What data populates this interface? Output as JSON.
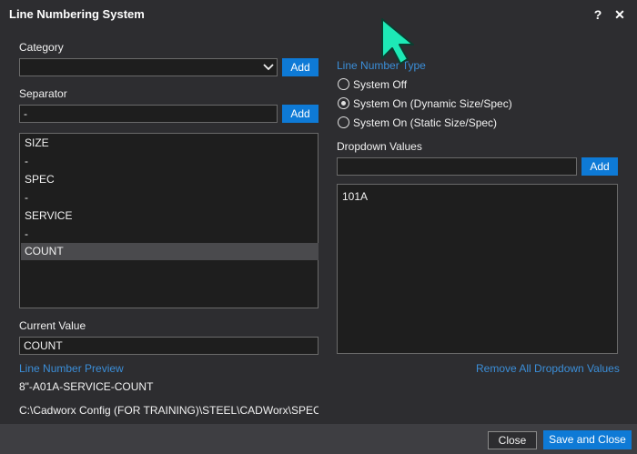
{
  "window": {
    "title": "Line Numbering System",
    "help_glyph": "?",
    "close_glyph": "✕"
  },
  "category": {
    "label": "Category",
    "value": "",
    "add_label": "Add"
  },
  "separator": {
    "label": "Separator",
    "value": "-",
    "add_label": "Add"
  },
  "sequence_items": [
    "SIZE",
    "-",
    "SPEC",
    "-",
    "SERVICE",
    "-",
    "COUNT"
  ],
  "current_value": {
    "label": "Current Value",
    "value": "COUNT"
  },
  "preview": {
    "label": "Line Number Preview",
    "value": "8\"-A01A-SERVICE-COUNT",
    "path": "C:\\Cadworx Config (FOR TRAINING)\\STEEL\\CADWorx\\SPEC\\Atr"
  },
  "line_number_type": {
    "label": "Line Number Type",
    "options": [
      "System Off",
      "System On (Dynamic Size/Spec)",
      "System On (Static Size/Spec)"
    ],
    "selected": "System On (Dynamic Size/Spec)"
  },
  "dropdown_values": {
    "label": "Dropdown Values",
    "input_value": "",
    "add_label": "Add",
    "items": [
      "101A"
    ],
    "remove_all_label": "Remove All Dropdown Values"
  },
  "footer": {
    "close_label": "Close",
    "save_close_label": "Save and Close"
  },
  "colors": {
    "accent": "#0e7ad6",
    "link": "#3b8ed8",
    "background": "#2d2d30",
    "field": "#1e1e1e",
    "cursor": "#1de9b6"
  }
}
